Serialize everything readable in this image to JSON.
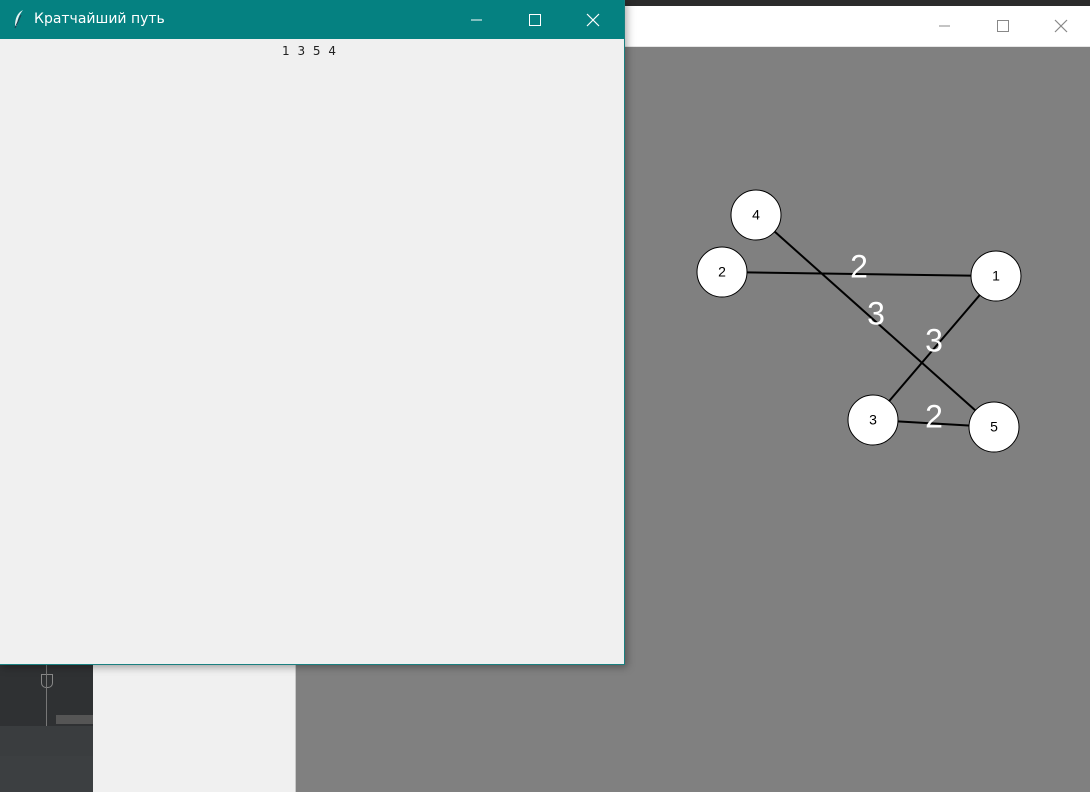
{
  "result_window": {
    "title": "Кратчайший путь",
    "path_text": "1 3 5 4",
    "titlebar_color": "#058181",
    "icons": {
      "app": "feather-icon",
      "minimize": "minimize-icon",
      "maximize": "maximize-icon",
      "close": "close-icon"
    }
  },
  "graph_window": {
    "title": "",
    "canvas_color": "#808080",
    "icons": {
      "minimize": "minimize-icon",
      "maximize": "maximize-icon",
      "close": "close-icon"
    }
  },
  "graph": {
    "nodes": [
      {
        "id": "1",
        "label": "1"
      },
      {
        "id": "2",
        "label": "2"
      },
      {
        "id": "3",
        "label": "3"
      },
      {
        "id": "4",
        "label": "4"
      },
      {
        "id": "5",
        "label": "5"
      }
    ],
    "edges": [
      {
        "from": "2",
        "to": "1",
        "weight": "2"
      },
      {
        "from": "4",
        "to": "5",
        "weight": "3"
      },
      {
        "from": "3",
        "to": "1",
        "weight": "3"
      },
      {
        "from": "3",
        "to": "5",
        "weight": "2"
      }
    ]
  }
}
